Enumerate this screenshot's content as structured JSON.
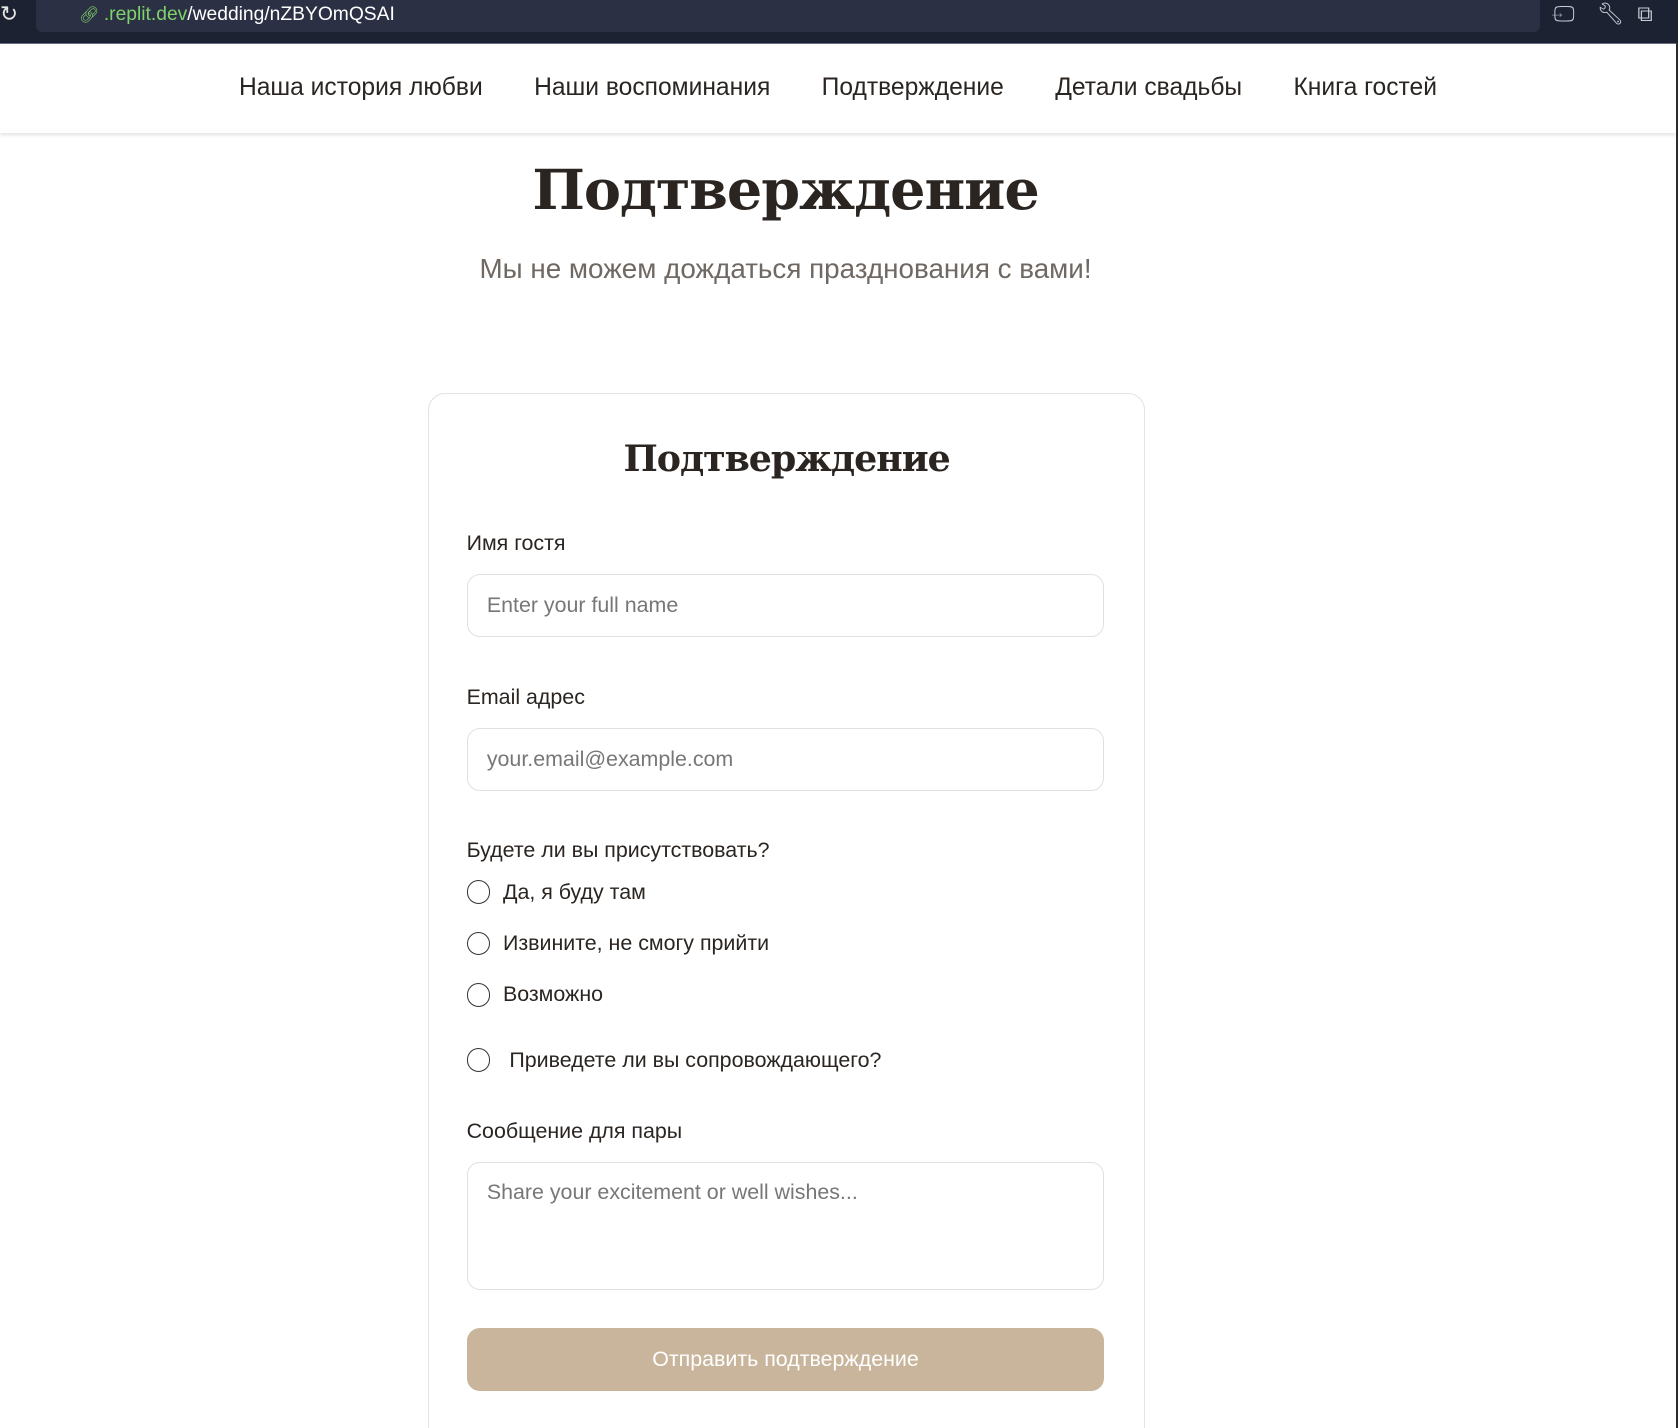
{
  "browser": {
    "url_host": ".replit.dev",
    "url_path": "/wedding/nZBYOmQSAI"
  },
  "nav": [
    "Наша история любви",
    "Наши воспоминания",
    "Подтверждение",
    "Детали свадьбы",
    "Книга гостей"
  ],
  "page": {
    "title": "Подтверждение",
    "subtitle": "Мы не можем дождаться празднования с вами!"
  },
  "form": {
    "title": "Подтверждение",
    "name_label": "Имя гостя",
    "name_placeholder": "Enter your full name",
    "email_label": "Email адрес",
    "email_placeholder": "your.email@example.com",
    "attend_label": "Будете ли вы присутствовать?",
    "options": [
      "Да, я буду там",
      "Извините, не смогу прийти",
      "Возможно"
    ],
    "plus_one": "Приведете ли вы сопровождающего?",
    "message_label": "Сообщение для пары",
    "message_placeholder": "Share your excitement or well wishes...",
    "submit": "Отправить подтверждение"
  }
}
